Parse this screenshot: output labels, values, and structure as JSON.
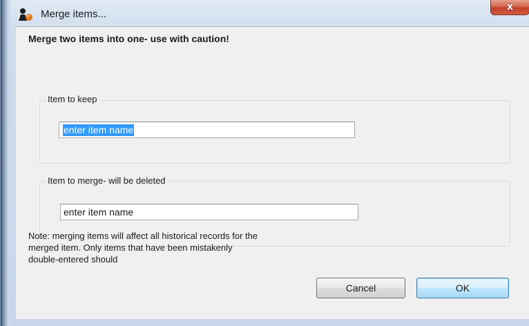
{
  "window": {
    "title": "Merge items...",
    "close_glyph": "x",
    "app_icon": "mSupply-app-icon"
  },
  "dialog": {
    "heading": "Merge two items into one- use with caution!",
    "keep_group": {
      "label": "Item to keep",
      "value": "enter item name"
    },
    "merge_group": {
      "label": "Item to merge- will be deleted",
      "value": "enter item name"
    },
    "note": "Note: merging items will affect all historical records for the merged item. Only items that have been mistakenly double-entered should",
    "cancel_label": "Cancel",
    "ok_label": "OK"
  },
  "colors": {
    "selection": "#3399ff",
    "close_button": "#c2412a",
    "default_button_border": "#3c7fb1"
  }
}
